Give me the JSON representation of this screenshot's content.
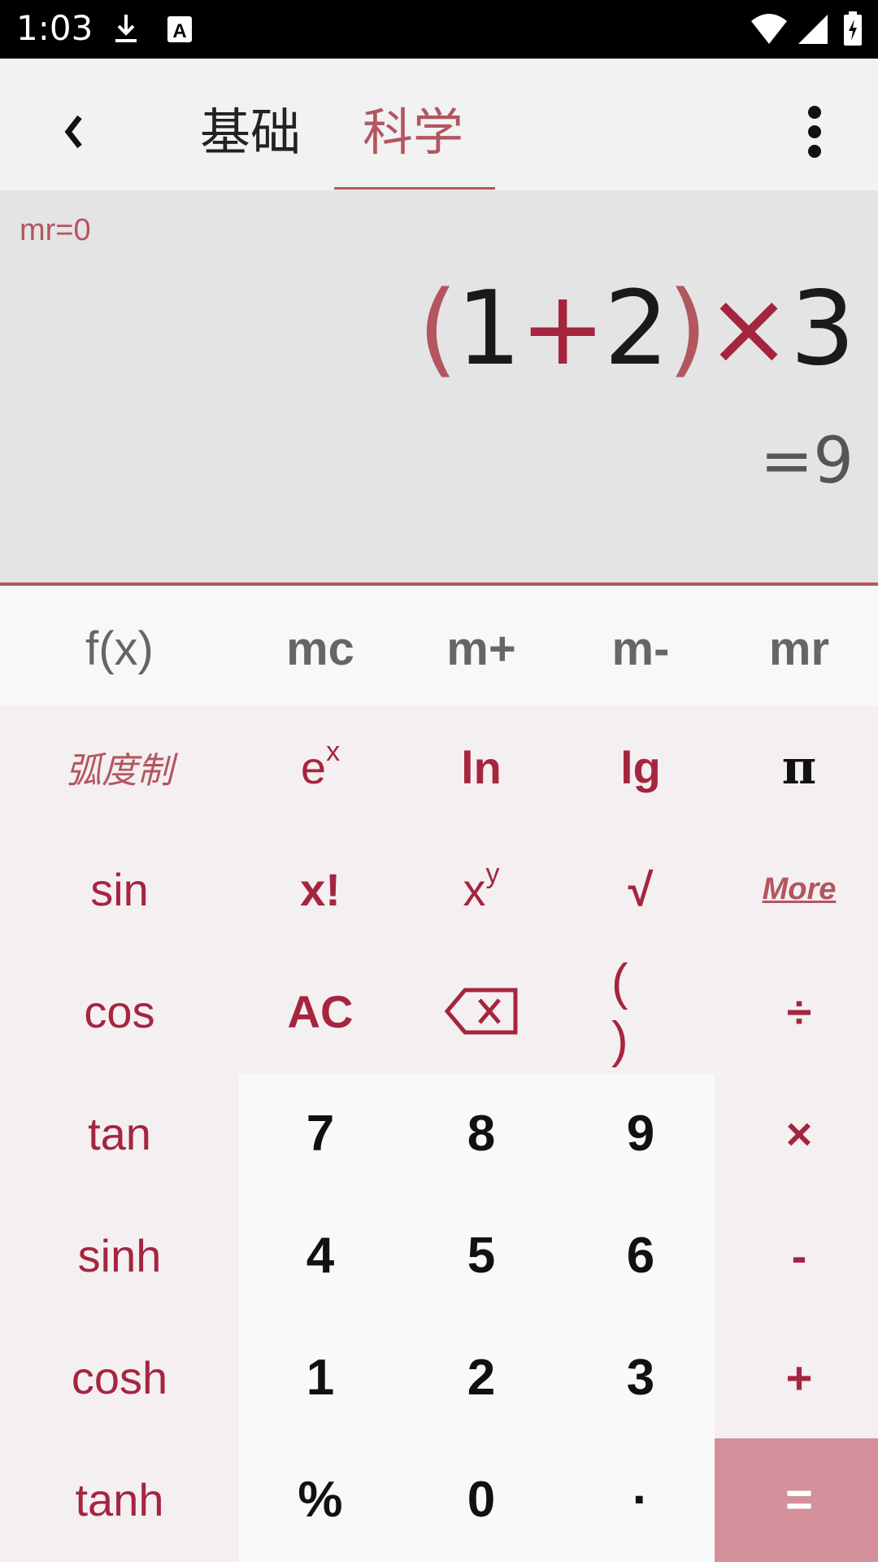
{
  "status_bar": {
    "time": "1:03"
  },
  "tabs": {
    "basic": "基础",
    "scientific": "科学",
    "active": "科学"
  },
  "display": {
    "memory": "mr=0",
    "expression": {
      "p_open": "(",
      "a": "1",
      "plus": "+",
      "b": "2",
      "p_close": ")",
      "times": "×",
      "c": "3"
    },
    "result": "=9"
  },
  "memory_row": {
    "fx": "f(x)",
    "mc": "mc",
    "mplus": "m+",
    "mminus": "m-",
    "mr": "mr"
  },
  "keys": {
    "radian": "弧度制",
    "e": "e",
    "e_exp": "x",
    "ln": "ln",
    "lg": "lg",
    "pi": "π",
    "sin": "sin",
    "fact": "x!",
    "x": "x",
    "x_exp": "y",
    "sqrt": "√",
    "more": "More",
    "cos": "cos",
    "ac": "AC",
    "parens": "( )",
    "div": "÷",
    "tan": "tan",
    "n7": "7",
    "n8": "8",
    "n9": "9",
    "mul": "×",
    "sinh": "sinh",
    "n4": "4",
    "n5": "5",
    "n6": "6",
    "minus": "-",
    "cosh": "cosh",
    "n1": "1",
    "n2": "2",
    "n3": "3",
    "plus": "+",
    "tanh": "tanh",
    "percent": "%",
    "n0": "0",
    "dot": "·",
    "equals": "="
  },
  "colors": {
    "accent": "#b25660",
    "key_text": "#a5253f",
    "equals_bg": "#d4909b"
  }
}
